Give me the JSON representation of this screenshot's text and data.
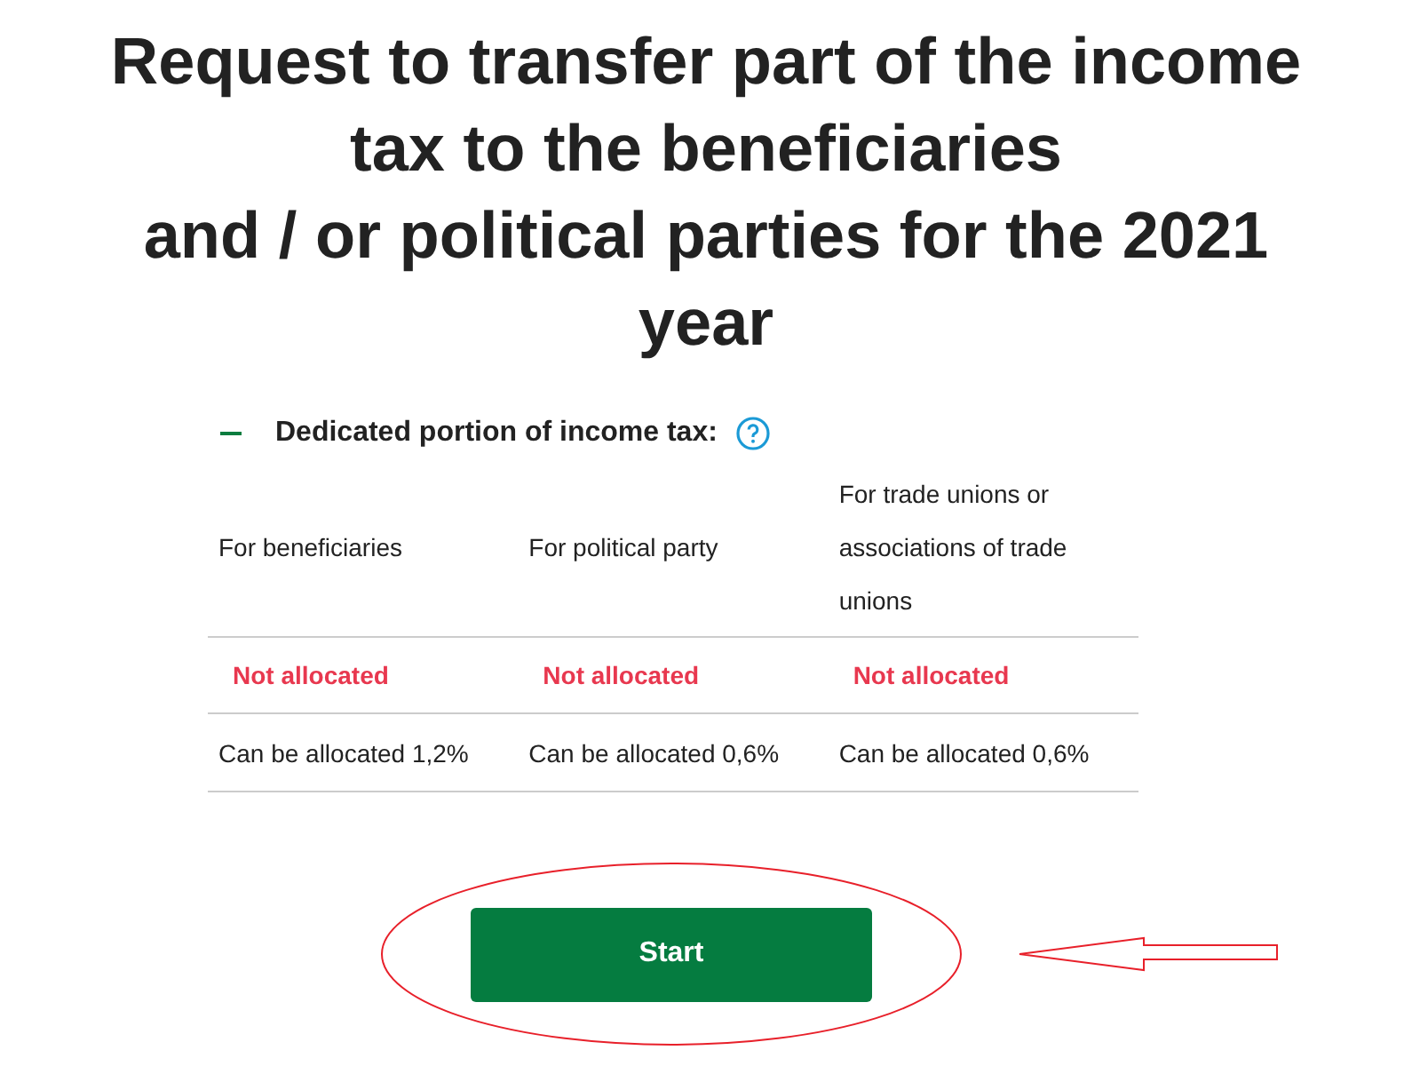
{
  "title_lines": [
    "Request to transfer part of the income",
    "tax to the beneficiaries",
    "and / or political parties for the 2021",
    "year"
  ],
  "section": {
    "title": "Dedicated portion of income tax:",
    "expanded": true,
    "columns": [
      "For beneficiaries",
      "For political party",
      "For trade unions or associations of trade unions"
    ],
    "rows": [
      {
        "kind": "status",
        "cells": [
          "Not allocated",
          "Not allocated",
          "Not allocated"
        ]
      },
      {
        "kind": "plain",
        "cells": [
          "Can be allocated 1,2%",
          "Can be allocated 0,6%",
          "Can be allocated 0,6%"
        ]
      }
    ]
  },
  "start_button": "Start"
}
